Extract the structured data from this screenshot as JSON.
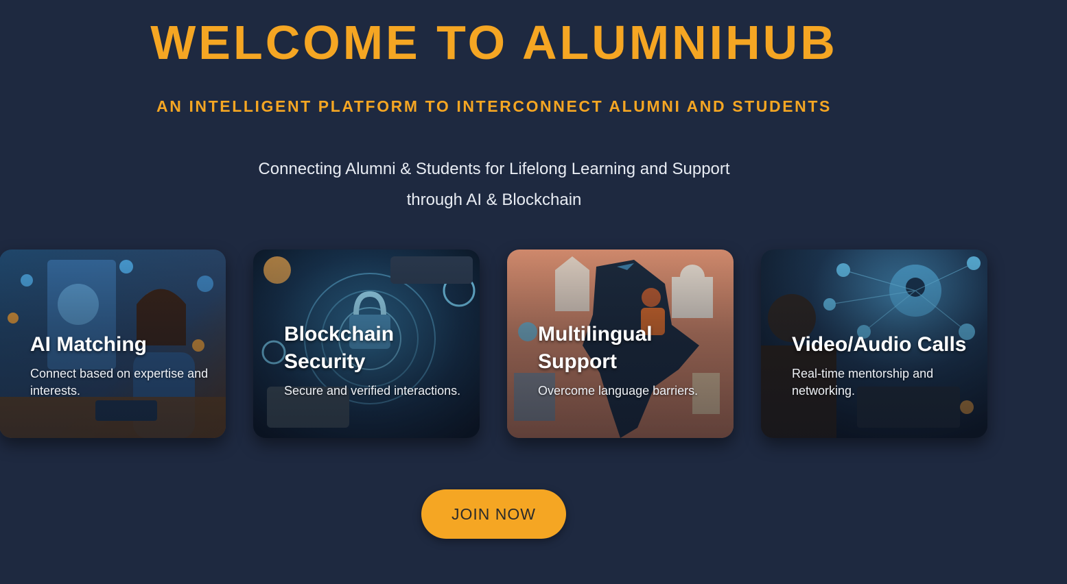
{
  "hero": {
    "title": "WELCOME TO ALUMNIHUB",
    "subtitle": "AN INTELLIGENT PLATFORM TO INTERCONNECT ALUMNI AND STUDENTS",
    "tagline_line1": "Connecting Alumni & Students for Lifelong Learning and Support",
    "tagline_line2": "through AI & Blockchain"
  },
  "features": [
    {
      "title": "AI Matching",
      "description": "Connect based on expertise and interests.",
      "icon": "ai-matching-illustration"
    },
    {
      "title": "Blockchain Security",
      "description": "Secure and verified interactions.",
      "icon": "blockchain-lock-illustration"
    },
    {
      "title": "Multilingual Support",
      "description": "Overcome language barriers.",
      "icon": "india-map-illustration"
    },
    {
      "title": "Video/Audio Calls",
      "description": "Real-time mentorship and networking.",
      "icon": "video-network-illustration"
    }
  ],
  "cta": {
    "join_label": "JOIN NOW"
  },
  "colors": {
    "background": "#1e2940",
    "accent": "#f5a623",
    "text_light": "#e8ecf3"
  }
}
